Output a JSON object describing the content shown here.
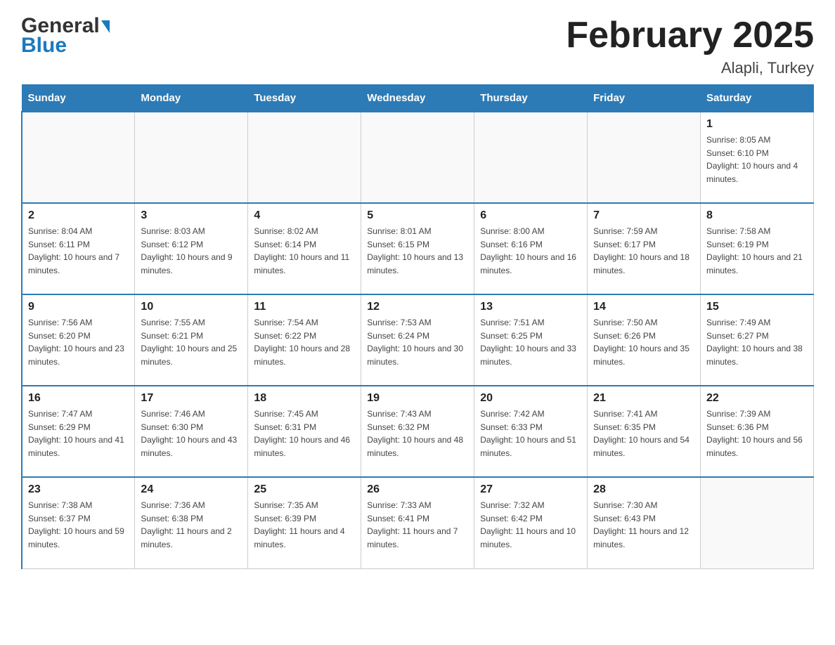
{
  "header": {
    "logo_general": "General",
    "logo_blue": "Blue",
    "title": "February 2025",
    "subtitle": "Alapli, Turkey"
  },
  "calendar": {
    "days_of_week": [
      "Sunday",
      "Monday",
      "Tuesday",
      "Wednesday",
      "Thursday",
      "Friday",
      "Saturday"
    ],
    "weeks": [
      [
        {
          "day": "",
          "info": ""
        },
        {
          "day": "",
          "info": ""
        },
        {
          "day": "",
          "info": ""
        },
        {
          "day": "",
          "info": ""
        },
        {
          "day": "",
          "info": ""
        },
        {
          "day": "",
          "info": ""
        },
        {
          "day": "1",
          "info": "Sunrise: 8:05 AM\nSunset: 6:10 PM\nDaylight: 10 hours and 4 minutes."
        }
      ],
      [
        {
          "day": "2",
          "info": "Sunrise: 8:04 AM\nSunset: 6:11 PM\nDaylight: 10 hours and 7 minutes."
        },
        {
          "day": "3",
          "info": "Sunrise: 8:03 AM\nSunset: 6:12 PM\nDaylight: 10 hours and 9 minutes."
        },
        {
          "day": "4",
          "info": "Sunrise: 8:02 AM\nSunset: 6:14 PM\nDaylight: 10 hours and 11 minutes."
        },
        {
          "day": "5",
          "info": "Sunrise: 8:01 AM\nSunset: 6:15 PM\nDaylight: 10 hours and 13 minutes."
        },
        {
          "day": "6",
          "info": "Sunrise: 8:00 AM\nSunset: 6:16 PM\nDaylight: 10 hours and 16 minutes."
        },
        {
          "day": "7",
          "info": "Sunrise: 7:59 AM\nSunset: 6:17 PM\nDaylight: 10 hours and 18 minutes."
        },
        {
          "day": "8",
          "info": "Sunrise: 7:58 AM\nSunset: 6:19 PM\nDaylight: 10 hours and 21 minutes."
        }
      ],
      [
        {
          "day": "9",
          "info": "Sunrise: 7:56 AM\nSunset: 6:20 PM\nDaylight: 10 hours and 23 minutes."
        },
        {
          "day": "10",
          "info": "Sunrise: 7:55 AM\nSunset: 6:21 PM\nDaylight: 10 hours and 25 minutes."
        },
        {
          "day": "11",
          "info": "Sunrise: 7:54 AM\nSunset: 6:22 PM\nDaylight: 10 hours and 28 minutes."
        },
        {
          "day": "12",
          "info": "Sunrise: 7:53 AM\nSunset: 6:24 PM\nDaylight: 10 hours and 30 minutes."
        },
        {
          "day": "13",
          "info": "Sunrise: 7:51 AM\nSunset: 6:25 PM\nDaylight: 10 hours and 33 minutes."
        },
        {
          "day": "14",
          "info": "Sunrise: 7:50 AM\nSunset: 6:26 PM\nDaylight: 10 hours and 35 minutes."
        },
        {
          "day": "15",
          "info": "Sunrise: 7:49 AM\nSunset: 6:27 PM\nDaylight: 10 hours and 38 minutes."
        }
      ],
      [
        {
          "day": "16",
          "info": "Sunrise: 7:47 AM\nSunset: 6:29 PM\nDaylight: 10 hours and 41 minutes."
        },
        {
          "day": "17",
          "info": "Sunrise: 7:46 AM\nSunset: 6:30 PM\nDaylight: 10 hours and 43 minutes."
        },
        {
          "day": "18",
          "info": "Sunrise: 7:45 AM\nSunset: 6:31 PM\nDaylight: 10 hours and 46 minutes."
        },
        {
          "day": "19",
          "info": "Sunrise: 7:43 AM\nSunset: 6:32 PM\nDaylight: 10 hours and 48 minutes."
        },
        {
          "day": "20",
          "info": "Sunrise: 7:42 AM\nSunset: 6:33 PM\nDaylight: 10 hours and 51 minutes."
        },
        {
          "day": "21",
          "info": "Sunrise: 7:41 AM\nSunset: 6:35 PM\nDaylight: 10 hours and 54 minutes."
        },
        {
          "day": "22",
          "info": "Sunrise: 7:39 AM\nSunset: 6:36 PM\nDaylight: 10 hours and 56 minutes."
        }
      ],
      [
        {
          "day": "23",
          "info": "Sunrise: 7:38 AM\nSunset: 6:37 PM\nDaylight: 10 hours and 59 minutes."
        },
        {
          "day": "24",
          "info": "Sunrise: 7:36 AM\nSunset: 6:38 PM\nDaylight: 11 hours and 2 minutes."
        },
        {
          "day": "25",
          "info": "Sunrise: 7:35 AM\nSunset: 6:39 PM\nDaylight: 11 hours and 4 minutes."
        },
        {
          "day": "26",
          "info": "Sunrise: 7:33 AM\nSunset: 6:41 PM\nDaylight: 11 hours and 7 minutes."
        },
        {
          "day": "27",
          "info": "Sunrise: 7:32 AM\nSunset: 6:42 PM\nDaylight: 11 hours and 10 minutes."
        },
        {
          "day": "28",
          "info": "Sunrise: 7:30 AM\nSunset: 6:43 PM\nDaylight: 11 hours and 12 minutes."
        },
        {
          "day": "",
          "info": ""
        }
      ]
    ]
  }
}
